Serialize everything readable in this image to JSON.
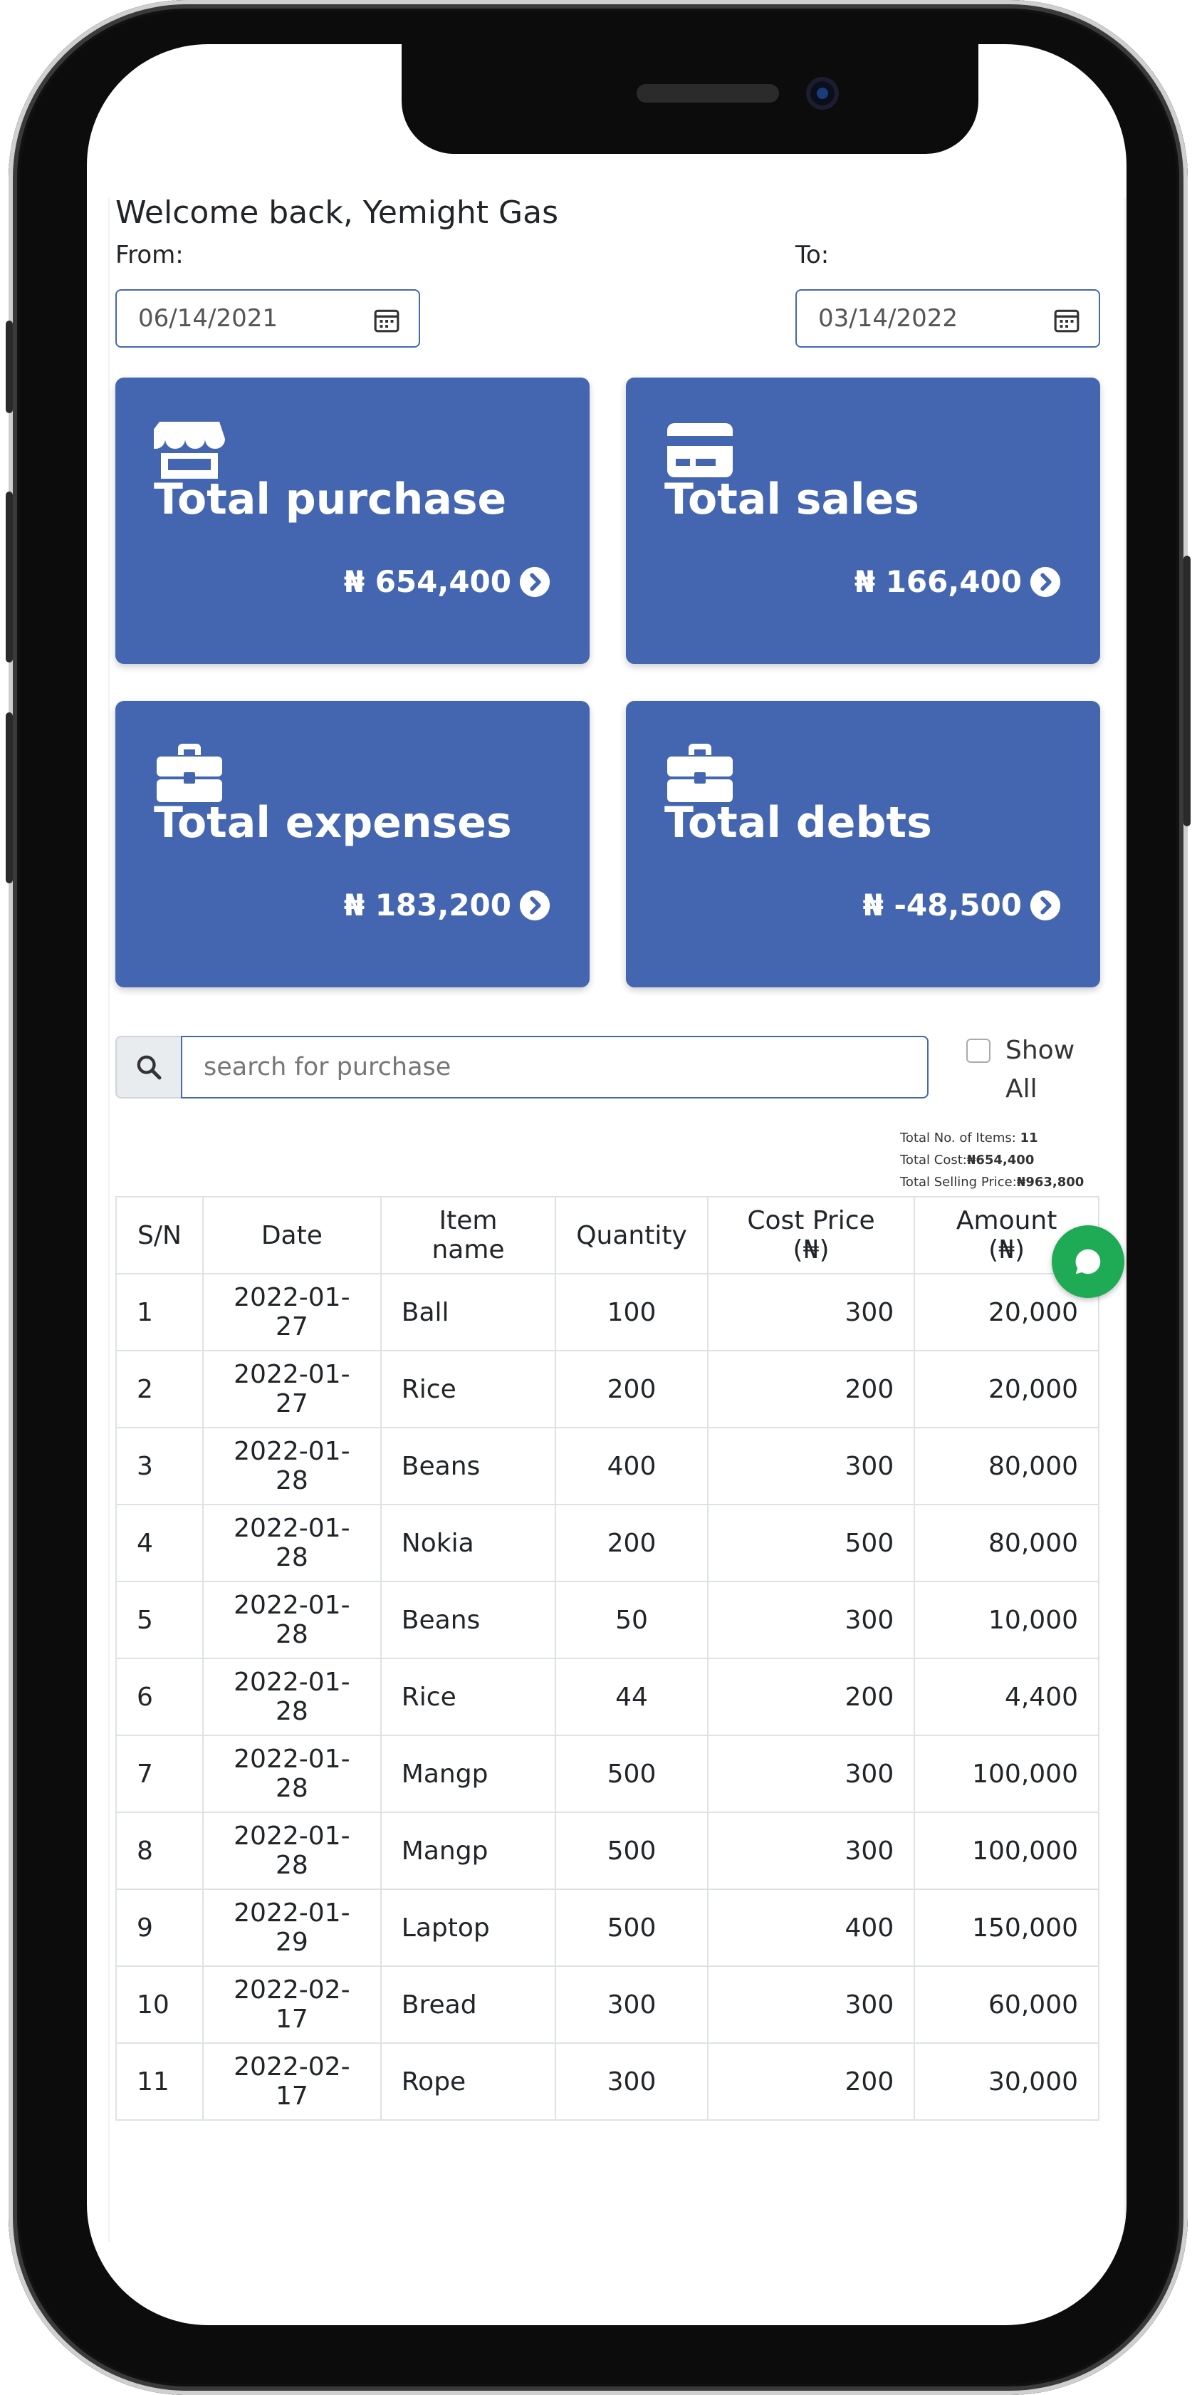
{
  "greeting": "Welcome back, Yemight Gas",
  "filters": {
    "from_label": "From:",
    "from_value": "06/14/2021",
    "to_label": "To:",
    "to_value": "03/14/2022"
  },
  "cards": [
    {
      "title": "Total purchase",
      "amount": "₦ 654,400",
      "icon": "shop-icon"
    },
    {
      "title": "Total sales",
      "amount": "₦ 166,400",
      "icon": "credit-card-icon"
    },
    {
      "title": "Total expenses",
      "amount": "₦ 183,200",
      "icon": "briefcase-icon"
    },
    {
      "title": "Total debts",
      "amount": "₦ -48,500",
      "icon": "briefcase-icon"
    }
  ],
  "search": {
    "placeholder": "search for purchase",
    "show_all_label": "Show All"
  },
  "totals": {
    "items_label": "Total No. of Items: ",
    "items_value": "11",
    "cost_label": "Total Cost:",
    "cost_value": "₦654,400",
    "selling_label": "Total Selling Price:",
    "selling_value": "₦963,800"
  },
  "table": {
    "headers": [
      "S/N",
      "Date",
      "Item name",
      "Quantity",
      "Cost Price (₦)",
      "Amount (₦)"
    ],
    "rows": [
      [
        "1",
        "2022-01-27",
        "Ball",
        "100",
        "300",
        "20,000"
      ],
      [
        "2",
        "2022-01-27",
        "Rice",
        "200",
        "200",
        "20,000"
      ],
      [
        "3",
        "2022-01-28",
        "Beans",
        "400",
        "300",
        "80,000"
      ],
      [
        "4",
        "2022-01-28",
        "Nokia",
        "200",
        "500",
        "80,000"
      ],
      [
        "5",
        "2022-01-28",
        "Beans",
        "50",
        "300",
        "10,000"
      ],
      [
        "6",
        "2022-01-28",
        "Rice",
        "44",
        "200",
        "4,400"
      ],
      [
        "7",
        "2022-01-28",
        "Mangp",
        "500",
        "300",
        "100,000"
      ],
      [
        "8",
        "2022-01-28",
        "Mangp",
        "500",
        "300",
        "100,000"
      ],
      [
        "9",
        "2022-01-29",
        "Laptop",
        "500",
        "400",
        "150,000"
      ],
      [
        "10",
        "2022-02-17",
        "Bread",
        "300",
        "300",
        "60,000"
      ],
      [
        "11",
        "2022-02-17",
        "Rope",
        "300",
        "200",
        "30,000"
      ]
    ]
  },
  "colors": {
    "card_blue": "#4466b0",
    "chat_green": "#1faa55",
    "input_border": "#4467b0"
  }
}
